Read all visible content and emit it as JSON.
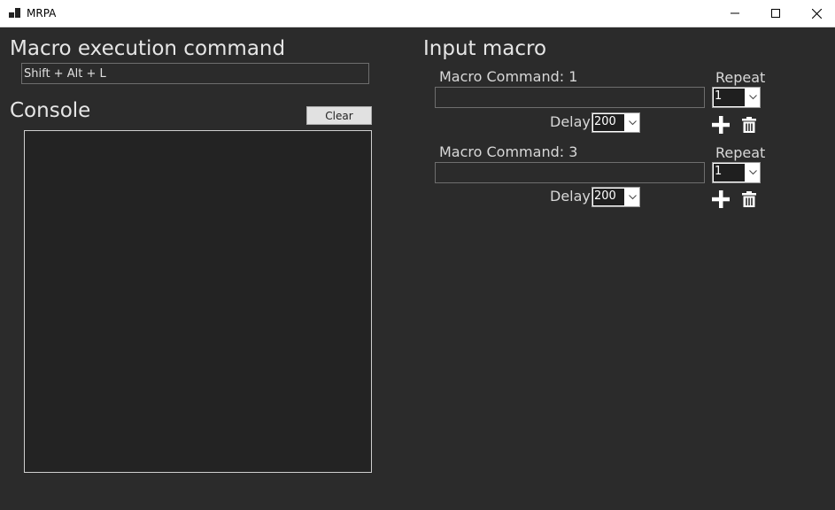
{
  "window": {
    "title": "MRPA"
  },
  "left": {
    "execution_heading": "Macro execution command",
    "execution_value": "Shift + Alt + L",
    "console_heading": "Console",
    "clear_label": "Clear",
    "console_text": ""
  },
  "right": {
    "heading": "Input macro",
    "macros": [
      {
        "label": "Macro Command: 1",
        "command_value": "",
        "repeat_label": "Repeat",
        "repeat_value": "1",
        "delay_label": "Delay",
        "delay_value": "200"
      },
      {
        "label": "Macro Command: 3",
        "command_value": "",
        "repeat_label": "Repeat",
        "repeat_value": "1",
        "delay_label": "Delay",
        "delay_value": "200"
      }
    ]
  },
  "icons": {
    "add": "plus-icon",
    "delete": "trash-icon",
    "app": "app-icon"
  },
  "colors": {
    "background": "#2b2b2b",
    "console_bg": "#232323",
    "text": "#e6e6e6"
  }
}
